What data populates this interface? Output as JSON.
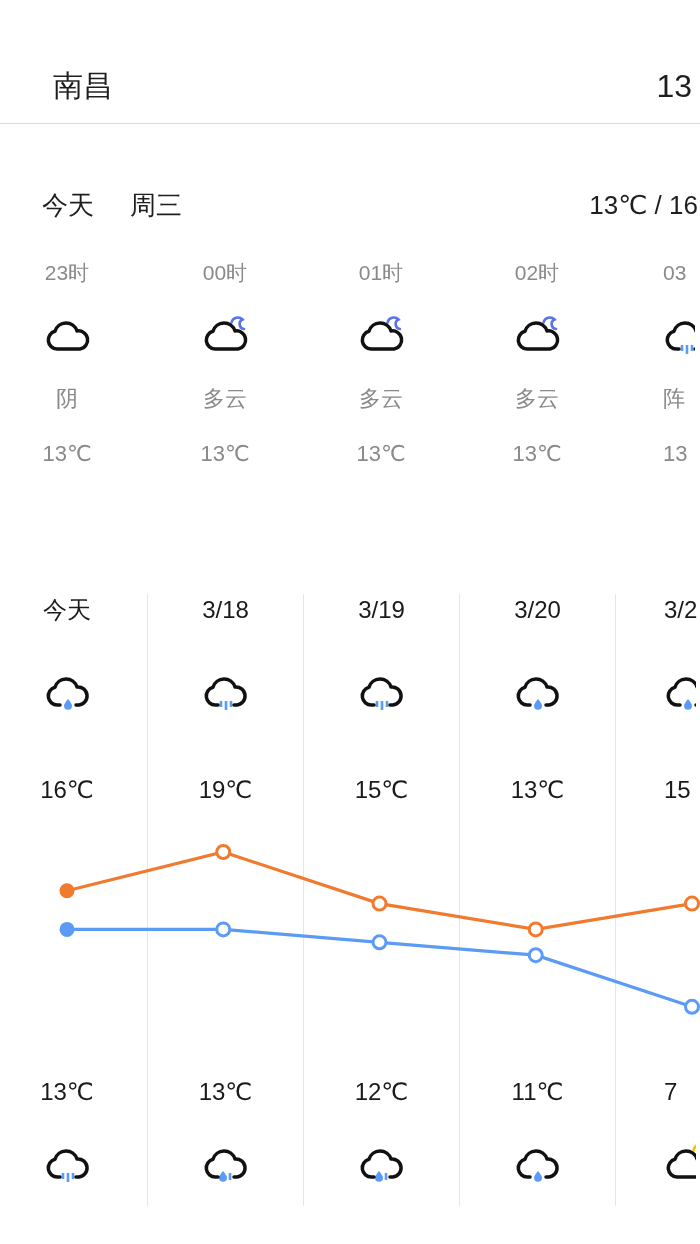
{
  "header": {
    "city": "南昌",
    "temp": "13"
  },
  "today": {
    "day": "今天",
    "weekday": "周三",
    "range": "13℃ / 16"
  },
  "hourly": [
    {
      "time": "23时",
      "icon": {
        "kind": "cloud"
      },
      "condition": "阴",
      "temp": "13℃"
    },
    {
      "time": "00时",
      "icon": {
        "kind": "moon"
      },
      "condition": "多云",
      "temp": "13℃"
    },
    {
      "time": "01时",
      "icon": {
        "kind": "moon"
      },
      "condition": "多云",
      "temp": "13℃"
    },
    {
      "time": "02时",
      "icon": {
        "kind": "moon"
      },
      "condition": "多云",
      "temp": "13℃"
    },
    {
      "time": "03",
      "icon": {
        "kind": "lines"
      },
      "condition": "阵",
      "temp": "13"
    }
  ],
  "daily": {
    "days": [
      {
        "date": "今天",
        "day_icon": {
          "kind": "drop"
        },
        "night_icon": {
          "kind": "lines"
        }
      },
      {
        "date": "3/18",
        "day_icon": {
          "kind": "lines"
        },
        "night_icon": {
          "kind": "dropline"
        }
      },
      {
        "date": "3/19",
        "day_icon": {
          "kind": "lines"
        },
        "night_icon": {
          "kind": "dropline"
        }
      },
      {
        "date": "3/20",
        "day_icon": {
          "kind": "drop"
        },
        "night_icon": {
          "kind": "drop"
        }
      },
      {
        "date": "3/2",
        "day_icon": {
          "kind": "drop"
        },
        "night_icon": {
          "kind": "sun"
        }
      }
    ],
    "chart_data": {
      "type": "line",
      "series": [
        {
          "color": "#f07a2e",
          "marker": true,
          "values": [
            16,
            19,
            15,
            13,
            15
          ],
          "value_labels": [
            "16℃",
            "19℃",
            "15℃",
            "13℃",
            "15"
          ]
        },
        {
          "color": "#5b9bf5",
          "marker": true,
          "values": [
            13,
            13,
            12,
            11,
            7
          ],
          "value_labels": [
            "13℃",
            "13℃",
            "12℃",
            "11℃",
            "7"
          ]
        }
      ]
    }
  }
}
